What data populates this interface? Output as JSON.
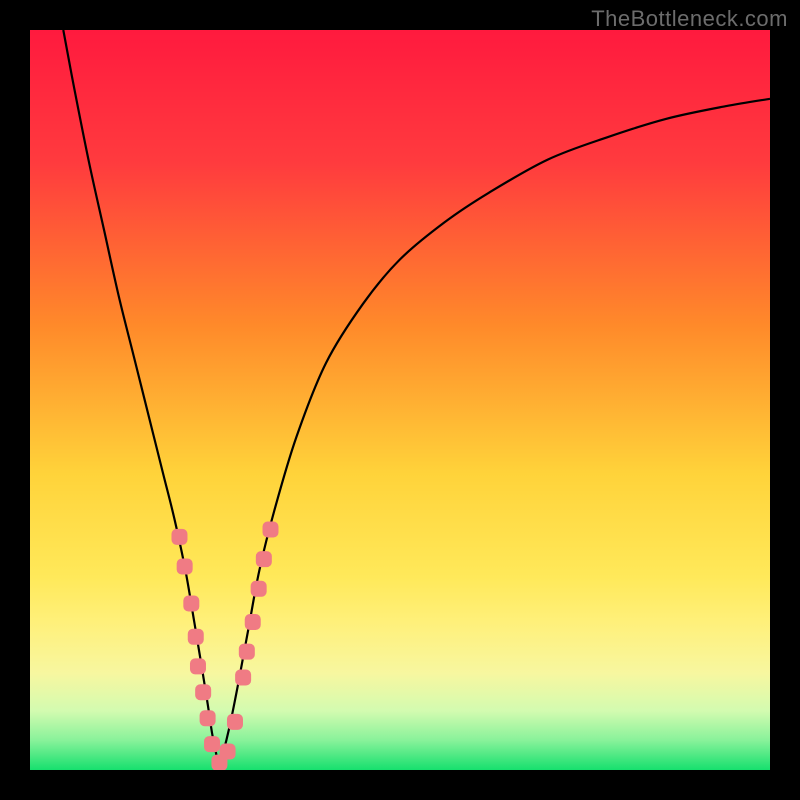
{
  "watermark": "TheBottleneck.com",
  "chart_data": {
    "type": "line",
    "title": "",
    "xlabel": "",
    "ylabel": "",
    "xlim": [
      0,
      100
    ],
    "ylim": [
      0,
      100
    ],
    "grid": false,
    "legend": false,
    "gradient_stops": [
      {
        "pct": 0,
        "color": "#ff1a3e"
      },
      {
        "pct": 18,
        "color": "#ff3b3e"
      },
      {
        "pct": 40,
        "color": "#ff8a2a"
      },
      {
        "pct": 60,
        "color": "#ffd33a"
      },
      {
        "pct": 74,
        "color": "#ffe95a"
      },
      {
        "pct": 80,
        "color": "#fff07a"
      },
      {
        "pct": 87,
        "color": "#f7f7a0"
      },
      {
        "pct": 92,
        "color": "#d3fbb0"
      },
      {
        "pct": 96,
        "color": "#88f29a"
      },
      {
        "pct": 100,
        "color": "#16e06e"
      }
    ],
    "series": [
      {
        "name": "bottleneck-curve",
        "color": "#000000",
        "width": 2.2,
        "x": [
          4.5,
          6,
          8,
          10,
          12,
          14,
          16,
          18,
          19.5,
          21,
          22.2,
          23.2,
          24,
          24.6,
          25.1,
          25.5,
          26,
          27,
          28.2,
          29.5,
          31,
          33,
          36,
          40,
          45,
          50,
          56,
          62,
          70,
          78,
          86,
          94,
          100
        ],
        "y": [
          100,
          92,
          82,
          73,
          64,
          56,
          48,
          40,
          34,
          27,
          20,
          14,
          9,
          5,
          2.5,
          0.7,
          2,
          6,
          12,
          19,
          27,
          35,
          45,
          55,
          63,
          69,
          74,
          78,
          82.5,
          85.5,
          88,
          89.7,
          90.7
        ]
      }
    ],
    "markers": {
      "name": "data-points",
      "shape": "rounded-square",
      "color": "#f07b84",
      "size": 16,
      "points": [
        {
          "x": 20.2,
          "y": 31.5
        },
        {
          "x": 20.9,
          "y": 27.5
        },
        {
          "x": 21.8,
          "y": 22.5
        },
        {
          "x": 22.4,
          "y": 18.0
        },
        {
          "x": 22.7,
          "y": 14.0
        },
        {
          "x": 23.4,
          "y": 10.5
        },
        {
          "x": 24.0,
          "y": 7.0
        },
        {
          "x": 24.6,
          "y": 3.5
        },
        {
          "x": 25.6,
          "y": 1.0
        },
        {
          "x": 26.7,
          "y": 2.5
        },
        {
          "x": 27.7,
          "y": 6.5
        },
        {
          "x": 28.8,
          "y": 12.5
        },
        {
          "x": 29.3,
          "y": 16.0
        },
        {
          "x": 30.1,
          "y": 20.0
        },
        {
          "x": 30.9,
          "y": 24.5
        },
        {
          "x": 31.6,
          "y": 28.5
        },
        {
          "x": 32.5,
          "y": 32.5
        }
      ]
    }
  }
}
